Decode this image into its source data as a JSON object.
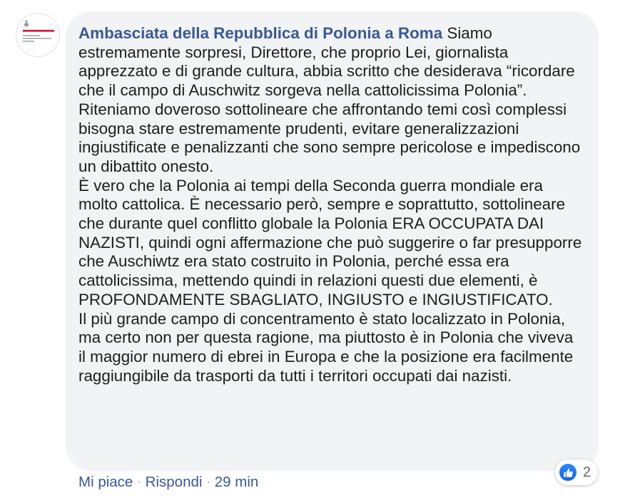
{
  "comment": {
    "author": "Ambasciata della Repubblica di Polonia a Roma",
    "text": "Siamo estremamente sorpresi, Direttore, che proprio Lei, giornalista apprezzato e di grande cultura, abbia scritto che desiderava “ricordare che il campo di Auschwitz sorgeva nella cattolicissima Polonia”.\nRiteniamo doveroso sottolineare che affrontando temi così complessi bisogna stare estremamente prudenti, evitare generalizzazioni ingiustificate e penalizzanti che sono sempre pericolose e impediscono un dibattito onesto.\nÈ vero che la Polonia ai tempi della Seconda guerra mondiale era molto cattolica. È necessario però, sempre e soprattutto, sottolineare che durante quel conflitto globale la Polonia ERA OCCUPATA DAI NAZISTI, quindi ogni affermazione che può suggerire o far presupporre che Auschiwtz era stato costruito in Polonia, perché essa era cattolicissima, mettendo quindi in relazioni questi due elementi, è PROFONDAMENTE SBAGLIATO, INGIUSTO e INGIUSTIFICATO.\nIl più grande campo di concentramento è stato localizzato in Polonia, ma certo non per questa ragione, ma piuttosto è in Polonia che viveva il maggior numero di ebrei in Europa e che la posizione era facilmente raggiungibile da trasporti da tutti i territori occupati dai nazisti.",
    "avatar": {
      "icon": "polish-eagle-emblem",
      "logo_text": "Ambasciata della Repubblica di Polonia a Roma"
    },
    "reactions": {
      "icon": "thumbs-up-icon",
      "count": "2"
    },
    "actions": {
      "like": "Mi piace",
      "reply": "Rispondi",
      "separator": "·",
      "time": "29 min"
    }
  },
  "colors": {
    "author": "#385898",
    "bubble": "#f2f3f5",
    "text": "#1c1e21",
    "meta": "#90949c",
    "like_blue": "#1877f2",
    "flag_red": "#dc143c"
  }
}
